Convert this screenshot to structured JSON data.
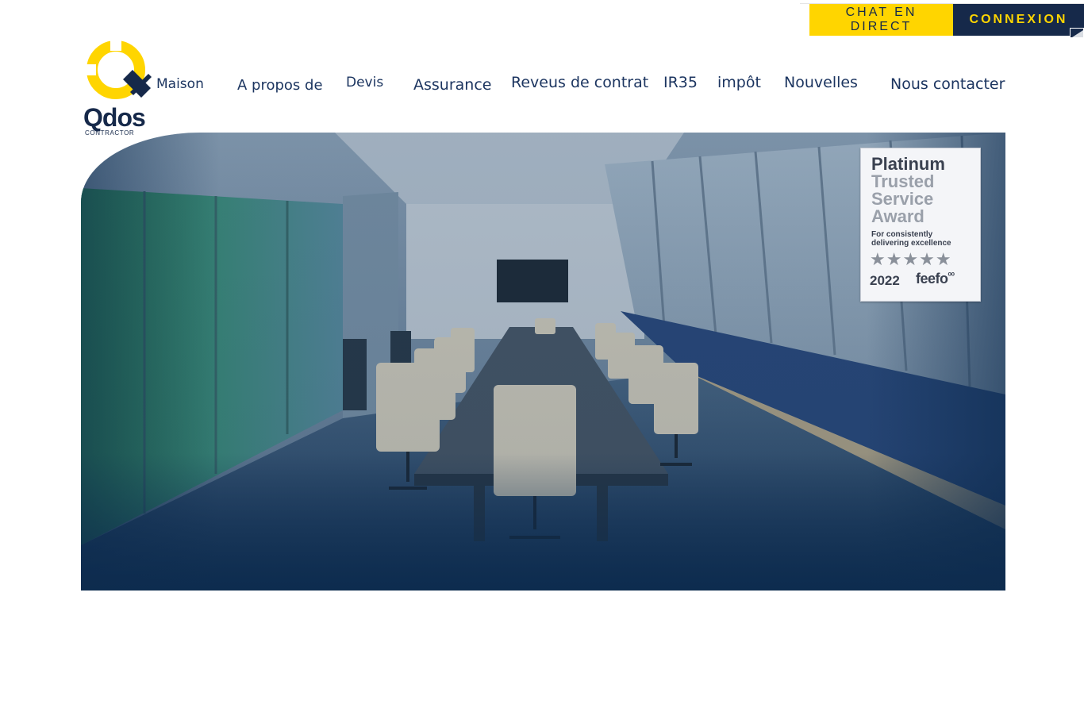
{
  "top_bar": {
    "chat_label": "CHAT EN DIRECT",
    "login_label": "CONNEXION"
  },
  "logo": {
    "word": "Qdos",
    "sub": "CONTRACTOR"
  },
  "nav": {
    "items": [
      {
        "label": "Maison"
      },
      {
        "label": "A propos de"
      },
      {
        "label": "Devis"
      },
      {
        "label": "Assurance"
      },
      {
        "label": "Reveus de contrat"
      },
      {
        "label": "IR35"
      },
      {
        "label": "impôt"
      },
      {
        "label": "Nouvelles"
      },
      {
        "label": "Nous contacter"
      }
    ]
  },
  "award": {
    "line1": "Platinum",
    "line2": "Trusted",
    "line3": "Service",
    "line4": "Award",
    "sub1": "For consistently",
    "sub2": "delivering excellence",
    "stars": "★★★★★",
    "year": "2022",
    "brand": "feefo",
    "brand_mark": "ᵒᵒ"
  },
  "colors": {
    "navy": "#16294a",
    "yellow": "#ffd500",
    "nav_text": "#1c3560"
  }
}
